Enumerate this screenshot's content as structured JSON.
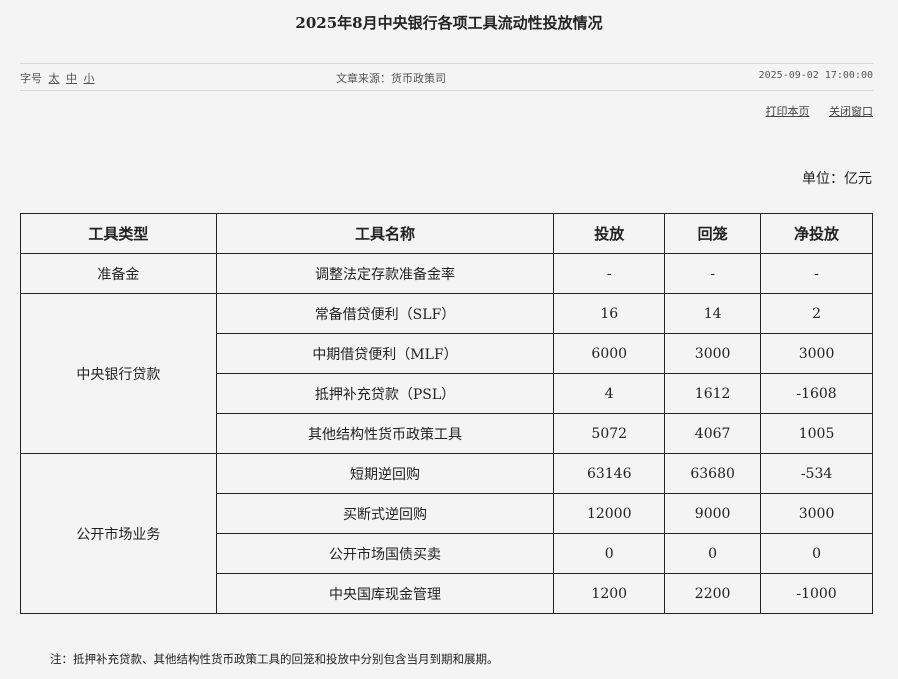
{
  "title": "2025年8月中央银行各项工具流动性投放情况",
  "meta": {
    "font_size_label": "字号",
    "font_sizes": [
      "太",
      "中",
      "小"
    ],
    "source": "文章来源：货币政策司",
    "datetime": "2025-09-02 17:00:00"
  },
  "actions": {
    "print": "打印本页",
    "close": "关闭窗口"
  },
  "unit": "单位：亿元",
  "table": {
    "headers": [
      "工具类型",
      "工具名称",
      "投放",
      "回笼",
      "净投放"
    ],
    "groups": [
      {
        "type": "准备金",
        "rows": [
          {
            "name": "调整法定存款准备金率",
            "release": "-",
            "withdraw": "-",
            "net": "-"
          }
        ]
      },
      {
        "type": "中央银行贷款",
        "rows": [
          {
            "name": "常备借贷便利（SLF）",
            "release": "16",
            "withdraw": "14",
            "net": "2"
          },
          {
            "name": "中期借贷便利（MLF）",
            "release": "6000",
            "withdraw": "3000",
            "net": "3000"
          },
          {
            "name": "抵押补充贷款（PSL）",
            "release": "4",
            "withdraw": "1612",
            "net": "-1608"
          },
          {
            "name": "其他结构性货币政策工具",
            "release": "5072",
            "withdraw": "4067",
            "net": "1005"
          }
        ]
      },
      {
        "type": "公开市场业务",
        "rows": [
          {
            "name": "短期逆回购",
            "release": "63146",
            "withdraw": "63680",
            "net": "-534"
          },
          {
            "name": "买断式逆回购",
            "release": "12000",
            "withdraw": "9000",
            "net": "3000"
          },
          {
            "name": "公开市场国债买卖",
            "release": "0",
            "withdraw": "0",
            "net": "0"
          },
          {
            "name": "中央国库现金管理",
            "release": "1200",
            "withdraw": "2200",
            "net": "-1000"
          }
        ]
      }
    ]
  },
  "note": "注：抵押补充贷款、其他结构性货币政策工具的回笼和投放中分别包含当月到期和展期。"
}
